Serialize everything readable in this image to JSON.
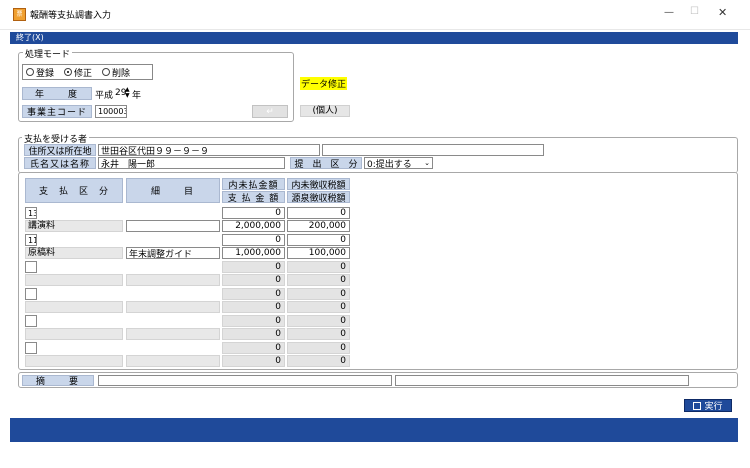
{
  "window": {
    "title": "報酬等支払調書入力",
    "minimize": "—",
    "maximize": "☐",
    "close": "✕"
  },
  "menu": {
    "exit": "終了(X)"
  },
  "mode_group": {
    "legend": "処理モード",
    "options": [
      {
        "label": "登録",
        "selected": false
      },
      {
        "label": "修正",
        "selected": true
      },
      {
        "label": "削除",
        "selected": false
      }
    ]
  },
  "year": {
    "label": "年　　度",
    "era": "平成",
    "value": "29",
    "unit": "年"
  },
  "business_code": {
    "label": "事業主コード",
    "value": "100003"
  },
  "enter_glyph": "↵",
  "mode_status": "データ修正",
  "person_type": "(個人)",
  "payee": {
    "legend": "支払を受ける者",
    "address_label": "住所又は所在地",
    "address_value": "世田谷区代田９９－９－９",
    "address_value2": "",
    "name_label": "氏名又は名称",
    "name_value": "永井　陽一郎",
    "submit_label": "提　出　区　分",
    "submit_value": "0:提出する"
  },
  "table": {
    "col_kubun": "支　払　区　分",
    "col_detail": "細　　目",
    "col_amount_1": "内未払金額",
    "col_amount_2": "支 払 金 額",
    "col_tax_1": "内未徴収税額",
    "col_tax_2": "源泉徴収税額",
    "rows": [
      {
        "code": "13",
        "kubun": "講演料",
        "detail": "",
        "unpaid": "0",
        "amount": "2,000,000",
        "uncollected": "0",
        "tax": "200,000"
      },
      {
        "code": "11",
        "kubun": "原稿料",
        "detail": "年末調整ガイド",
        "unpaid": "0",
        "amount": "1,000,000",
        "uncollected": "0",
        "tax": "100,000"
      },
      {
        "code": "",
        "kubun": "",
        "detail": "",
        "unpaid": "0",
        "amount": "0",
        "uncollected": "0",
        "tax": "0"
      },
      {
        "code": "",
        "kubun": "",
        "detail": "",
        "unpaid": "0",
        "amount": "0",
        "uncollected": "0",
        "tax": "0"
      },
      {
        "code": "",
        "kubun": "",
        "detail": "",
        "unpaid": "0",
        "amount": "0",
        "uncollected": "0",
        "tax": "0"
      },
      {
        "code": "",
        "kubun": "",
        "detail": "",
        "unpaid": "0",
        "amount": "0",
        "uncollected": "0",
        "tax": "0"
      }
    ]
  },
  "remarks": {
    "label": "摘　　要",
    "value1": "",
    "value2": ""
  },
  "execute_button": "実行",
  "colors": {
    "menu_bar": "#1f4a9a",
    "status_bar": "#1f4a9a",
    "label_bg": "#c9d6ea",
    "highlight": "#ffff00"
  }
}
